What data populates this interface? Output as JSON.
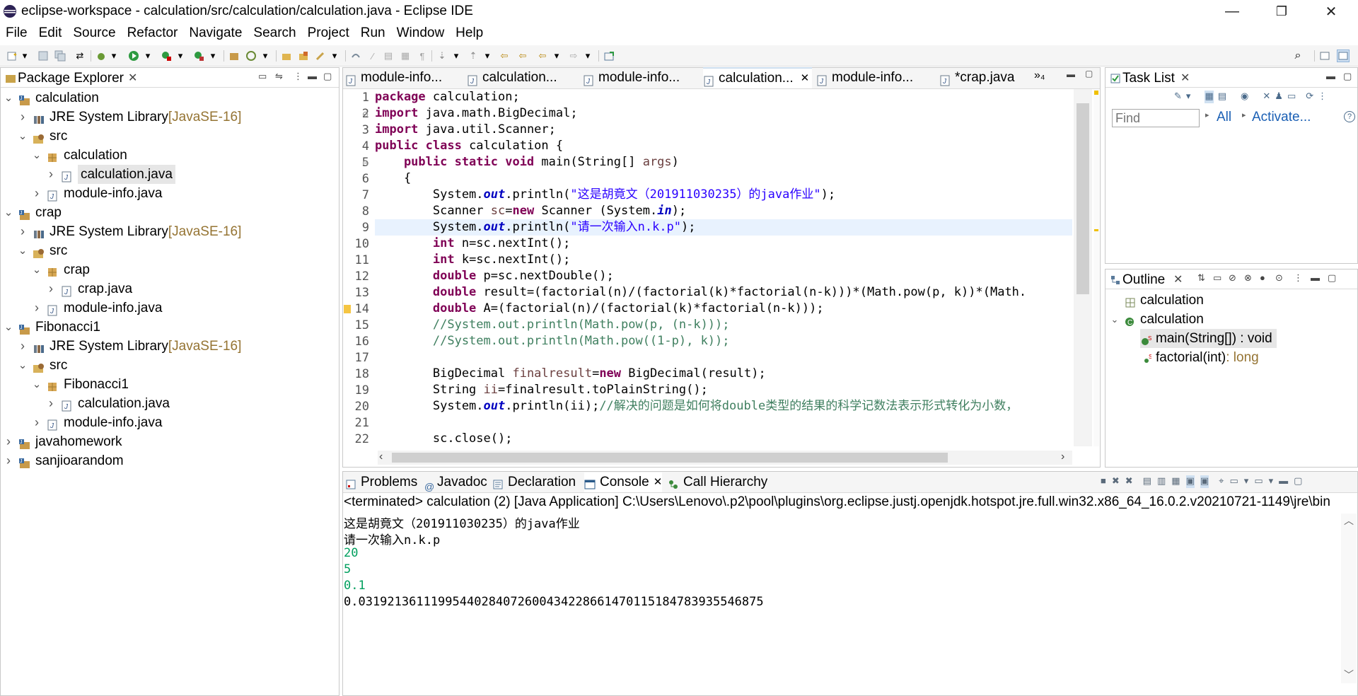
{
  "window": {
    "title": "eclipse-workspace - calculation/src/calculation/calculation.java - Eclipse IDE",
    "minimize": "—",
    "restore": "❐",
    "close": "✕"
  },
  "menu": [
    "File",
    "Edit",
    "Source",
    "Refactor",
    "Navigate",
    "Search",
    "Project",
    "Run",
    "Window",
    "Help"
  ],
  "package_explorer": {
    "title": "Package Explorer",
    "tree": [
      {
        "label": "calculation",
        "lib": ""
      },
      {
        "label": "JRE System Library ",
        "lib": "[JavaSE-16]"
      },
      {
        "label": "src",
        "lib": ""
      },
      {
        "label": "calculation",
        "lib": ""
      },
      {
        "label": "calculation.java",
        "lib": ""
      },
      {
        "label": "module-info.java",
        "lib": ""
      },
      {
        "label": "crap",
        "lib": ""
      },
      {
        "label": "JRE System Library ",
        "lib": "[JavaSE-16]"
      },
      {
        "label": "src",
        "lib": ""
      },
      {
        "label": "crap",
        "lib": ""
      },
      {
        "label": "crap.java",
        "lib": ""
      },
      {
        "label": "module-info.java",
        "lib": ""
      },
      {
        "label": "Fibonacci1",
        "lib": ""
      },
      {
        "label": "JRE System Library ",
        "lib": "[JavaSE-16]"
      },
      {
        "label": "src",
        "lib": ""
      },
      {
        "label": "Fibonacci1",
        "lib": ""
      },
      {
        "label": "calculation.java",
        "lib": ""
      },
      {
        "label": "module-info.java",
        "lib": ""
      },
      {
        "label": "javahomework",
        "lib": ""
      },
      {
        "label": "sanjioarandom",
        "lib": ""
      }
    ]
  },
  "editor_tabs": [
    "module-info...",
    "calculation...",
    "module-info...",
    "calculation...",
    "module-info...",
    "*crap.java"
  ],
  "editor_overflow": "»₄",
  "code_lines": [
    "1",
    "2",
    "3",
    "4",
    "5",
    "6",
    "7",
    "8",
    "9",
    "10",
    "11",
    "12",
    "13",
    "14",
    "15",
    "16",
    "17",
    "18",
    "19",
    "20",
    "21",
    "22"
  ],
  "code": {
    "l1a": "package",
    "l1b": " calculation;",
    "l2a": "import",
    "l2b": " java.math.BigDecimal;",
    "l3a": "import",
    "l3b": " java.util.Scanner;",
    "l4a": "public class",
    "l4b": " calculation {",
    "l5a": "    public static void",
    "l5b": " main(String[] ",
    "l5c": "args",
    "l6": "    {",
    "l7a": "        System.",
    "l7b": "out",
    ".": "",
    "l7c": ".println(",
    "l7d": "\"这是胡竟文（201911030235）的java作业\"",
    "l7e": ");",
    "l8a": "        Scanner ",
    "l8b": "sc",
    "l8c": "=",
    "l8d": "new",
    "l8e": " Scanner (System.",
    "l8f": "in",
    "l8g": ");",
    "l9a": "        System.",
    "l9b": "out",
    "l9c": ".println(",
    "l9d": "\"请一次输入n.k.p\"",
    "l9e": ");",
    "l10a": "        int",
    "l10b": " n=sc.nextInt();",
    "l11a": "        int",
    "l11b": " k=sc.nextInt();",
    "l12a": "        double",
    "l12b": " p=sc.nextDouble();",
    "l13a": "        double",
    "l13b": " result=(factorial(n)/(factorial(k)*factorial(n-k)))*(Math.pow(p, k))*(Math.",
    "l14a": "        double",
    "l14b": " A=(factorial(n)/(factorial(k)*factorial(n-k)));",
    "l15": "        //System.out.println(Math.pow(p, (n-k)));",
    "l16": "        //System.out.println(Math.pow((1-p), k));",
    "l18a": "        BigDecimal ",
    "l18b": "finalresult",
    "l18c": "=",
    "l18d": "new",
    "l18e": " BigDecimal(result);",
    "l19a": "        String ",
    "l19b": "ii",
    "l19c": "=finalresult.toPlainString();",
    "l20a": "        System.",
    "l20b": "out",
    "l20c": ".println(ii);",
    "l20d": "//解决的问题是如何将double类型的结果的科学记数法表示形式转化为小数，",
    "l22": "        sc.close();"
  },
  "task_list": {
    "title": "Task List",
    "find_placeholder": "Find",
    "all": "All",
    "activate": "Activate..."
  },
  "outline": {
    "title": "Outline",
    "items": [
      "calculation",
      "calculation",
      "main(String[]) : void",
      "factorial(int)"
    ],
    "factorial_ret": " : long"
  },
  "bottom_tabs": [
    "Problems",
    "Javadoc",
    "Declaration",
    "Console",
    "Call Hierarchy"
  ],
  "console": {
    "header": "<terminated> calculation (2) [Java Application] C:\\Users\\Lenovo\\.p2\\pool\\plugins\\org.eclipse.justj.openjdk.hotspot.jre.full.win32.x86_64_16.0.2.v20210721-1149\\jre\\bin",
    "lines": [
      "这是胡竟文（201911030235）的java作业",
      "请一次输入n.k.p",
      "20",
      "5",
      "0.1",
      "0.031921361119954402840726004342286614701151847839355468 75"
    ],
    "result": "0.03192136111995440284072600434228661470115184783935546875"
  },
  "colors": {
    "keyword": "#7f0055",
    "string": "#2a00ff",
    "comment": "#3f7f5f",
    "field": "#0000c0",
    "lib": "#957433",
    "input": "#009f5e"
  }
}
